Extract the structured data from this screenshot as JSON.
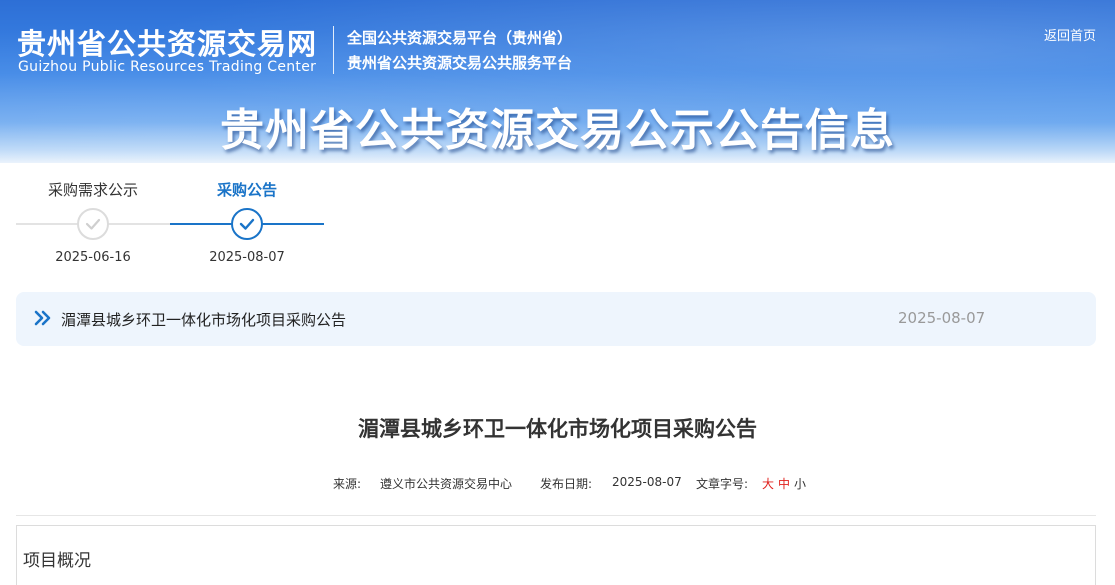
{
  "header": {
    "logo_cn": "贵州省公共资源交易网",
    "logo_en": "Guizhou Public Resources Trading Center",
    "platform_line1": "全国公共资源交易平台（贵州省）",
    "platform_line2": "贵州省公共资源交易公共服务平台",
    "back_home": "返回首页",
    "banner_title": "贵州省公共资源交易公示公告信息"
  },
  "steps": [
    {
      "label": "采购需求公示",
      "date": "2025-06-16",
      "state": "done",
      "icon": "check-circle-icon"
    },
    {
      "label": "采购公告",
      "date": "2025-08-07",
      "state": "active",
      "icon": "check-circle-icon"
    }
  ],
  "notice": {
    "icon": "double-chevron-right-icon",
    "title": "湄潭县城乡环卫一体化市场化项目采购公告",
    "date": "2025-08-07"
  },
  "article": {
    "title": "湄潭县城乡环卫一体化市场化项目采购公告",
    "source_label": "来源:",
    "source": "遵义市公共资源交易中心",
    "date_label": "发布日期:",
    "date": "2025-08-07",
    "size_label": "文章字号:",
    "size_large": "大",
    "size_medium": "中",
    "size_small": "小",
    "section_title": "项目概况"
  },
  "colors": {
    "accent": "#1a74c8",
    "highlight_red": "#e0201c",
    "notice_bg": "#eef5fd"
  }
}
